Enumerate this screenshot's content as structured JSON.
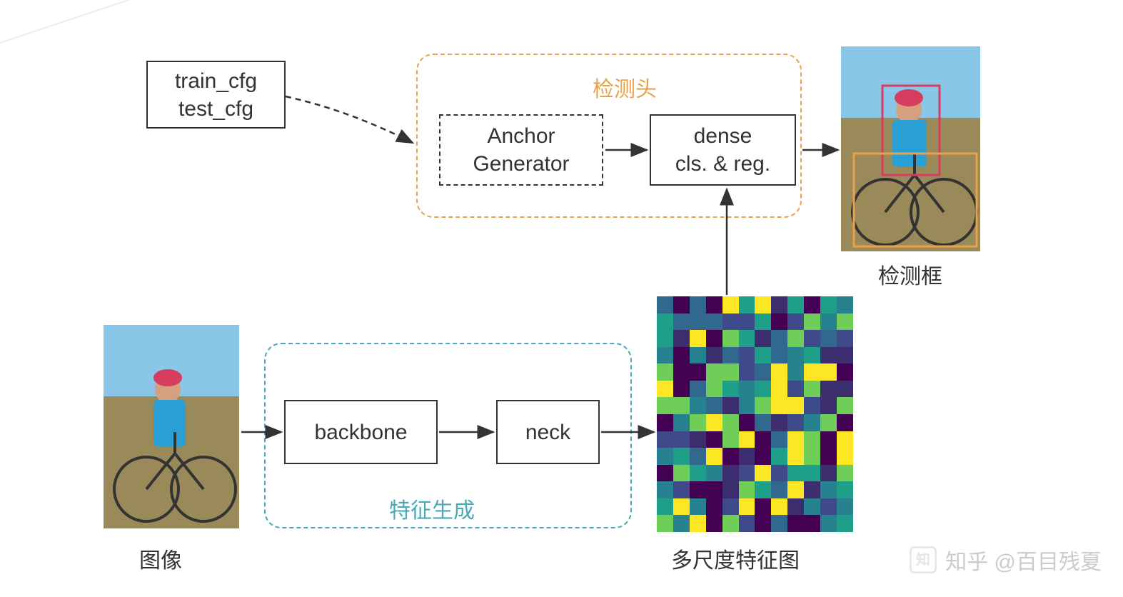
{
  "boxes": {
    "cfg_line1": "train_cfg",
    "cfg_line2": "test_cfg",
    "anchor_line1": "Anchor",
    "anchor_line2": "Generator",
    "dense_line1": "dense",
    "dense_line2": "cls. & reg.",
    "backbone": "backbone",
    "neck": "neck"
  },
  "regions": {
    "head_label": "检测头",
    "feature_label": "特征生成"
  },
  "captions": {
    "input_image": "图像",
    "feature_map": "多尺度特征图",
    "output": "检测框"
  },
  "watermark": {
    "text": "知乎 @百目残夏"
  },
  "colors": {
    "head_region": "#e8a34a",
    "feature_region": "#4aa8b8",
    "head_label": "#e8a34a",
    "feature_label": "#4aa8b8"
  },
  "feature_map_palette": [
    "#3b2d6e",
    "#3e4a89",
    "#26828e",
    "#6ece58",
    "#fde725",
    "#1f9e89",
    "#440154",
    "#31688e"
  ]
}
